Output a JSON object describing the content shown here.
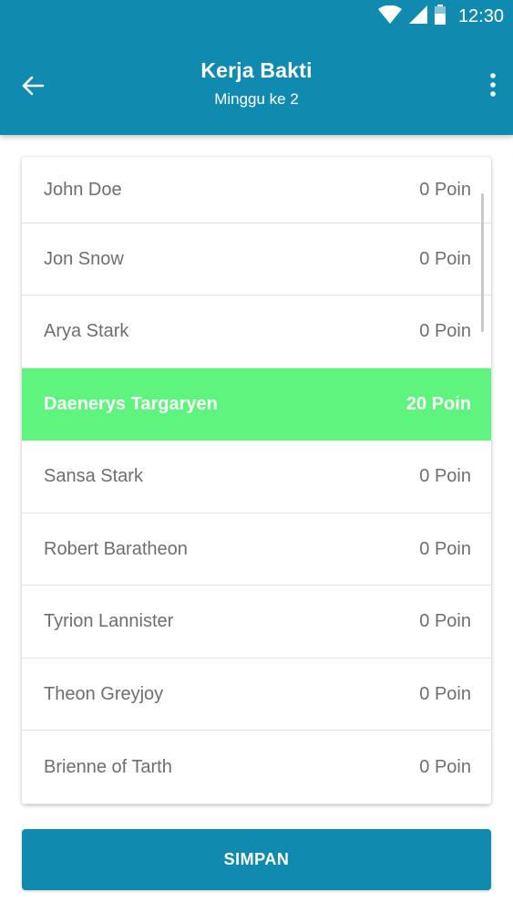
{
  "status_bar": {
    "time": "12:30",
    "icons": [
      "wifi-icon",
      "signal-icon",
      "battery-icon"
    ]
  },
  "app_bar": {
    "title": "Kerja Bakti",
    "subtitle": "Minggu ke 2",
    "background": "#118ab0"
  },
  "list": {
    "items": [
      {
        "name": "John Doe",
        "points": "0 Poin",
        "selected": false
      },
      {
        "name": "Jon Snow",
        "points": "0 Poin",
        "selected": false
      },
      {
        "name": "Arya Stark",
        "points": "0 Poin",
        "selected": false
      },
      {
        "name": "Daenerys Targaryen",
        "points": "20 Poin",
        "selected": true
      },
      {
        "name": "Sansa Stark",
        "points": "0 Poin",
        "selected": false
      },
      {
        "name": "Robert Baratheon",
        "points": "0 Poin",
        "selected": false
      },
      {
        "name": "Tyrion Lannister",
        "points": "0 Poin",
        "selected": false
      },
      {
        "name": "Theon Greyjoy",
        "points": "0 Poin",
        "selected": false
      },
      {
        "name": "Brienne of Tarth",
        "points": "0 Poin",
        "selected": false
      }
    ],
    "selected_color": "#5ff47d"
  },
  "actions": {
    "save_label": "SIMPAN"
  }
}
